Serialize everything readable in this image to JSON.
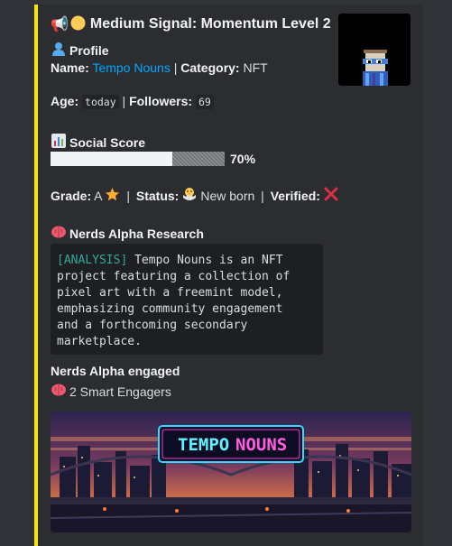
{
  "embed": {
    "accent_color": "#f5e50a",
    "title_icons": [
      "megaphone-icon",
      "yellow-circle-icon"
    ],
    "title": "Medium Signal: Momentum Level 2",
    "profile": {
      "icon": "bust-silhouette-icon",
      "heading": "Profile",
      "name_label": "Name:",
      "name_value": "Tempo Nouns",
      "separator1": " | ",
      "category_label": "Category:",
      "category_value": "NFT",
      "age_label": "Age:",
      "age_value": "today",
      "separator2": " | ",
      "followers_label": "Followers:",
      "followers_value": "69"
    },
    "social_score": {
      "icon": "bar-chart-icon",
      "heading": "Social Score",
      "progress": 0.7,
      "percent_label": "70%"
    },
    "grade": {
      "grade_label": "Grade:",
      "grade_value": "A",
      "grade_icon": "star-icon",
      "separator1": " | ",
      "status_label": "Status:",
      "status_icon": "hatching-chick-icon",
      "status_value": "New born",
      "separator2": " | ",
      "verified_label": "Verified:",
      "verified_icon": "red-x-icon"
    },
    "research": {
      "icon": "brain-icon",
      "heading": "Nerds Alpha Research",
      "tag": "[ANALYSIS]",
      "text": " Tempo Nouns is an NFT\nproject featuring a collection of\npixel art with a freemint model,\nemphasizing community engagement\nand a forthcoming secondary\nmarketplace."
    },
    "engaged": {
      "heading": "Nerds Alpha engaged",
      "icon": "brain-icon",
      "text": "2 Smart Engagers"
    },
    "banner": {
      "title_part1": "TEMPO",
      "title_part2": "NOUNS"
    }
  }
}
